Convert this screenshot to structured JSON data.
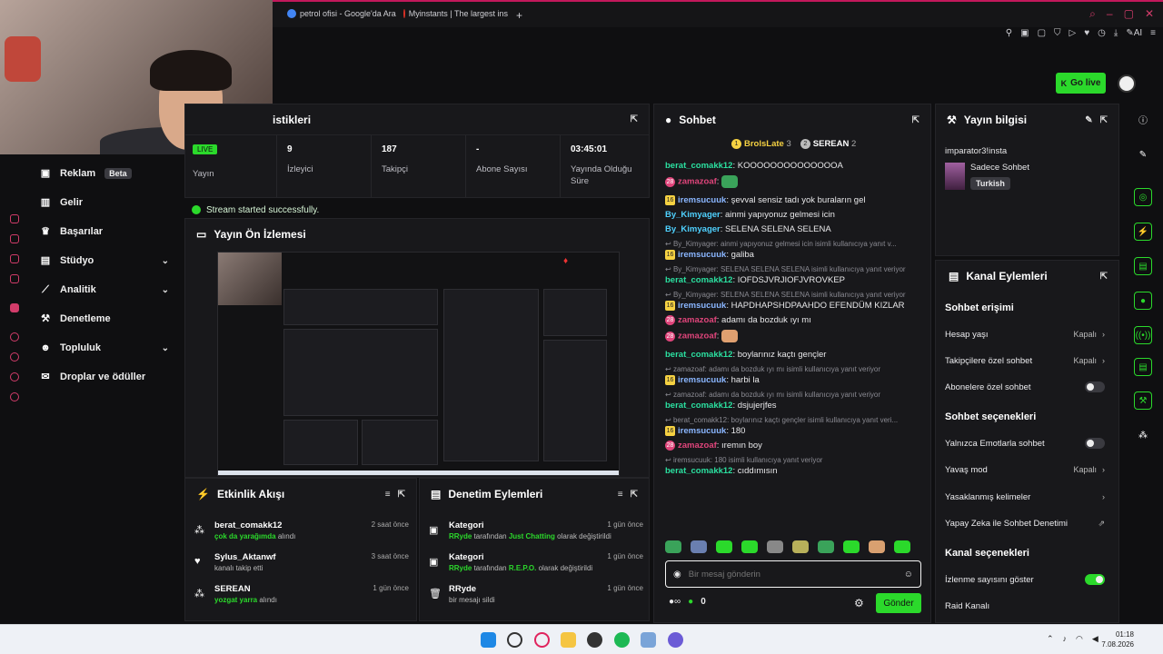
{
  "browser": {
    "tabs": [
      {
        "label": "petrol ofisi - Google'da Ara",
        "color": "#4285f4"
      },
      {
        "label": "Myinstants | The largest ins",
        "color": "#d93025"
      }
    ],
    "new_tab": "+",
    "ai_label": "AI"
  },
  "header": {
    "go_live_label": "Go live"
  },
  "nav": {
    "items": [
      {
        "label": "Reklam",
        "badge": "Beta",
        "icon": "ad-icon"
      },
      {
        "label": "Gelir",
        "icon": "revenue-icon"
      },
      {
        "label": "Başarılar",
        "icon": "trophy-icon"
      },
      {
        "label": "Stüdyo",
        "icon": "studio-icon",
        "chevron": true
      },
      {
        "label": "Analitik",
        "icon": "analytics-icon",
        "chevron": true
      },
      {
        "label": "Denetleme",
        "icon": "wrench-icon"
      },
      {
        "label": "Topluluk",
        "icon": "community-icon",
        "chevron": true
      },
      {
        "label": "Droplar ve ödüller",
        "icon": "gift-icon"
      }
    ]
  },
  "stats": {
    "title": "istikleri",
    "items": [
      {
        "value": "",
        "label": "Yayın"
      },
      {
        "value": "9",
        "label": "İzleyici"
      },
      {
        "value": "187",
        "label": "Takipçi"
      },
      {
        "value": "-",
        "label": "Abone Sayısı"
      },
      {
        "value": "03:45:01",
        "label": "Yayında Olduğu Süre"
      }
    ],
    "status_message": "Stream started successfully."
  },
  "preview": {
    "title": "Yayın Ön İzlemesi"
  },
  "chat": {
    "title": "Sohbet",
    "leaders": [
      {
        "name": "BrolsLate",
        "count": "3",
        "rank": "1"
      },
      {
        "name": "SEREAN",
        "count": "2",
        "rank": "2"
      }
    ],
    "messages": [
      {
        "user": "berat_comakk12",
        "color": "green",
        "text": ": KOOOOOOOOOOOOOOA"
      },
      {
        "user": "zamazoaf",
        "color": "pink",
        "badge": "28",
        "text": ":",
        "emote": "#3aa35a"
      },
      {
        "user": "iremsucuuk",
        "color": "blue",
        "badge": "16",
        "text": ": şevval sensiz tadı yok buraların gel"
      },
      {
        "user": "By_Kimyager",
        "color": "cyan",
        "text": ": ainmi yapıyonuz gelmesi icin"
      },
      {
        "user": "By_Kimyager",
        "color": "cyan",
        "text": ": SELENA SELENA SELENA"
      },
      {
        "reply": "By_Kimyager: ainmi yapıyonuz gelmesi icin isimli kullanıcıya yanıt v..."
      },
      {
        "user": "iremsucuuk",
        "color": "blue",
        "badge": "16",
        "text": ": galiba"
      },
      {
        "reply": "By_Kimyager: SELENA SELENA SELENA isimli kullanıcıya yanıt veriyor"
      },
      {
        "user": "berat_comakk12",
        "color": "green",
        "text": ": IOFDSJVRJIOFJVROVKEP"
      },
      {
        "reply": "By_Kimyager: SELENA SELENA SELENA isimli kullanıcıya yanıt veriyor"
      },
      {
        "user": "iremsucuuk",
        "color": "blue",
        "badge": "16",
        "text": ": HAPDHAPSHDPAAHDO EFENDÜM KIZLAR"
      },
      {
        "user": "zamazoaf",
        "color": "pink",
        "badge": "28",
        "text": ": adamı da bozduk ıyı mı"
      },
      {
        "user": "zamazoaf",
        "color": "pink",
        "badge": "28",
        "text": ":",
        "emote": "#e0a070"
      },
      {
        "user": "berat_comakk12",
        "color": "green",
        "text": ": boylarınız kaçtı gençler"
      },
      {
        "reply": "zamazoaf: adamı da bozduk ıyı mı isimli kullanıcıya yanıt veriyor"
      },
      {
        "user": "iremsucuuk",
        "color": "blue",
        "badge": "16",
        "text": ": harbi la"
      },
      {
        "reply": "zamazoaf: adamı da bozduk ıyı mı isimli kullanıcıya yanıt veriyor"
      },
      {
        "user": "berat_comakk12",
        "color": "green",
        "text": ": dsjujerjfes"
      },
      {
        "reply": "berat_comakk12: boylarınız kaçtı gençler isimli kullanıcıya yanıt veri..."
      },
      {
        "user": "iremsucuuk",
        "color": "blue",
        "badge": "16",
        "text": ": 180"
      },
      {
        "user": "zamazoaf",
        "color": "pink",
        "badge": "28",
        "text": ": ıremın boy"
      },
      {
        "reply": "iremsucuuk: 180 isimli kullanıcıya yanıt veriyor"
      },
      {
        "user": "berat_comakk12",
        "color": "green",
        "text": ": cıddımısın"
      }
    ],
    "input_placeholder": "Bir mesaj gönderin",
    "points": "0",
    "send_label": "Gönder"
  },
  "stream_info": {
    "title": "Yayın bilgisi",
    "stream_title": "imparator3!insta",
    "category": "Sadece Sohbet",
    "tag": "Turkish"
  },
  "channel_actions": {
    "title": "Kanal Eylemleri",
    "chat_access_title": "Sohbet erişimi",
    "chat_access": [
      {
        "label": "Hesap yaşı",
        "value": "Kapalı",
        "kind": "chevron"
      },
      {
        "label": "Takipçilere özel sohbet",
        "value": "Kapalı",
        "kind": "chevron"
      },
      {
        "label": "Abonelere özel sohbet",
        "kind": "toggle",
        "on": false
      }
    ],
    "chat_options_title": "Sohbet seçenekleri",
    "chat_options": [
      {
        "label": "Yalnızca Emotlarla sohbet",
        "kind": "toggle",
        "on": false
      },
      {
        "label": "Yavaş mod",
        "value": "Kapalı",
        "kind": "chevron"
      },
      {
        "label": "Yasaklanmış kelimeler",
        "kind": "chevron"
      },
      {
        "label": "Yapay Zeka ile Sohbet Denetimi",
        "kind": "external"
      }
    ],
    "channel_options_title": "Kanal seçenekleri",
    "channel_options": [
      {
        "label": "İzlenme sayısını göster",
        "kind": "toggle",
        "on": true
      },
      {
        "label": "Raid Kanalı",
        "kind": "none"
      }
    ]
  },
  "activity": {
    "title": "Etkinlik Akışı",
    "items": [
      {
        "name": "berat_comakk12",
        "highlight": "çok da yarağımda",
        "rest": " alındı",
        "time": "2 saat önce",
        "icon": "redeem-icon"
      },
      {
        "name": "Sylus_Aktanwf",
        "highlight": "",
        "rest": "kanalı takip etti",
        "time": "3 saat önce",
        "icon": "heart-icon"
      },
      {
        "name": "SEREAN",
        "highlight": "yozgat yarra",
        "rest": " alındı",
        "time": "1 gün önce",
        "icon": "redeem-icon"
      }
    ]
  },
  "moderation": {
    "title": "Denetim Eylemleri",
    "items": [
      {
        "name": "Kategori",
        "by": "RRyde",
        "mid": " tarafından ",
        "highlight": "Just Chatting",
        "rest": " olarak değiştirildi",
        "time": "1 gün önce",
        "icon": "category-icon"
      },
      {
        "name": "Kategori",
        "by": "RRyde",
        "mid": " tarafından ",
        "highlight": "R.E.P.O.",
        "rest": " olarak değiştirildi",
        "time": "1 gün önce",
        "icon": "category-icon"
      },
      {
        "name": "RRyde",
        "by": "",
        "mid": "",
        "highlight": "",
        "rest": "bir mesajı sildi",
        "time": "1 gün önce",
        "icon": "trash-icon"
      }
    ]
  },
  "taskbar": {
    "time": "01:18",
    "date": "7.08.2026"
  },
  "colors": {
    "accent": "#2bd92b",
    "brand": "#c2185b",
    "panel": "#18181b",
    "bg": "#0f0f11"
  }
}
